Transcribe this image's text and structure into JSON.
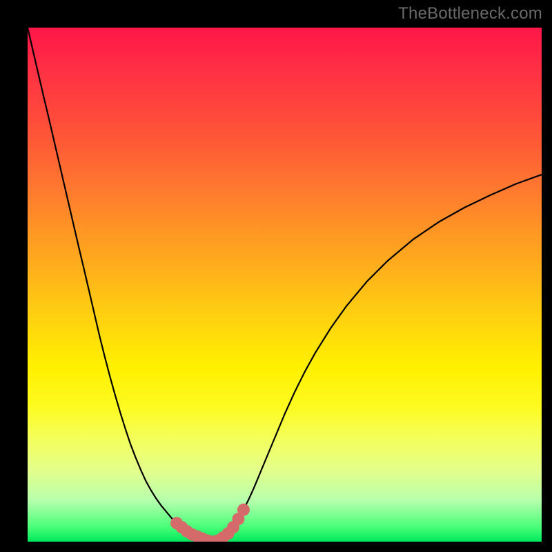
{
  "watermark": "TheBottleneck.com",
  "colors": {
    "frame": "#000000",
    "curve": "#000000",
    "marker": "#d46a6a",
    "gradient_top": "#ff1648",
    "gradient_bottom": "#00e85c"
  },
  "chart_data": {
    "type": "line",
    "title": "",
    "xlabel": "",
    "ylabel": "",
    "xlim": [
      0,
      100
    ],
    "ylim": [
      0,
      100
    ],
    "x": [
      0,
      1,
      2,
      3,
      4,
      5,
      6,
      7,
      8,
      9,
      10,
      11,
      12,
      13,
      14,
      15,
      16,
      17,
      18,
      19,
      20,
      21,
      22,
      23,
      24,
      25,
      26,
      27,
      28,
      29,
      30,
      31,
      32,
      33,
      34,
      35,
      36,
      37,
      38,
      39,
      40,
      41,
      42,
      43,
      44,
      45,
      46,
      47,
      48,
      49,
      50,
      51,
      52,
      53,
      54,
      55,
      56,
      57,
      58,
      59,
      60,
      61,
      62,
      63,
      64,
      65,
      66,
      67,
      68,
      69,
      70,
      75,
      80,
      85,
      90,
      95,
      100
    ],
    "y": [
      100,
      95.7,
      91.4,
      87.1,
      82.9,
      78.6,
      74.3,
      70,
      65.7,
      61.4,
      57.1,
      52.9,
      48.6,
      44.3,
      40,
      36,
      32.2,
      28.6,
      25.2,
      22,
      19,
      16.4,
      14,
      11.8,
      10,
      8.4,
      7,
      5.8,
      4.6,
      3.6,
      2.8,
      2,
      1.4,
      1,
      0.6,
      0.2,
      0,
      0.2,
      0.8,
      1.6,
      2.8,
      4.4,
      6.2,
      8.2,
      10.4,
      12.8,
      15.2,
      17.6,
      20,
      22.4,
      24.8,
      27,
      29.2,
      31.2,
      33.2,
      35,
      36.8,
      38.4,
      40,
      41.6,
      43,
      44.4,
      45.8,
      47,
      48.2,
      49.4,
      50.6,
      51.6,
      52.6,
      53.6,
      54.6,
      58.8,
      62.2,
      65,
      67.4,
      69.6,
      71.4
    ],
    "marker_points_x": [
      29,
      30,
      31,
      32,
      33,
      34,
      35,
      36,
      37,
      38,
      39,
      40,
      41,
      42
    ],
    "marker_points_y": [
      3.6,
      2.8,
      2,
      1.4,
      1,
      0.6,
      0.2,
      0,
      0.2,
      0.8,
      1.6,
      2.8,
      4.4,
      6.2
    ],
    "annotations": []
  }
}
